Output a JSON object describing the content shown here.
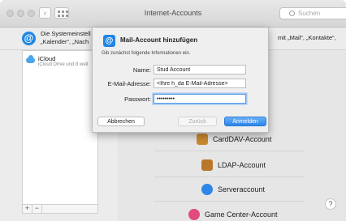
{
  "window": {
    "title": "Internet-Accounts",
    "search_placeholder": "Suchen"
  },
  "info": {
    "text_left_line1": "Die Systemeinstell",
    "text_left_line2": "„Kalender“, „Nach",
    "text_right": "mit „Mail“, „Kontakte“,"
  },
  "sidebar": {
    "items": [
      {
        "title": "iCloud",
        "subtitle": "iCloud Drive und 8 weit"
      }
    ],
    "footer": {
      "add": "+",
      "remove": "−"
    }
  },
  "accounts": [
    {
      "label": "CardDAV-Account",
      "icon": "carddav-icon",
      "color": "#c8892f"
    },
    {
      "label": "LDAP-Account",
      "icon": "ldap-icon",
      "color": "#b8772a"
    },
    {
      "label": "Serveraccount",
      "icon": "server-icon",
      "color": "#2f86e6"
    },
    {
      "label": "Game Center-Account",
      "icon": "game-center-icon",
      "color": "#e04b7c"
    }
  ],
  "sheet": {
    "title": "Mail-Account hinzufügen",
    "subtitle": "Gib zunächst folgende Informationen ein.",
    "name_label": "Name:",
    "name_value": "Stud Account",
    "email_label": "E-Mail-Adresse:",
    "email_value": "<Ihre h_da E-Mail-Adresse>",
    "password_label": "Passwort:",
    "password_value": "•••••••••",
    "cancel_label": "Abbrechen",
    "back_label": "Zurück",
    "login_label": "Anmelden"
  },
  "help_label": "?",
  "colors": {
    "accent": "#2a85ea",
    "window_bg": "#ececec"
  }
}
